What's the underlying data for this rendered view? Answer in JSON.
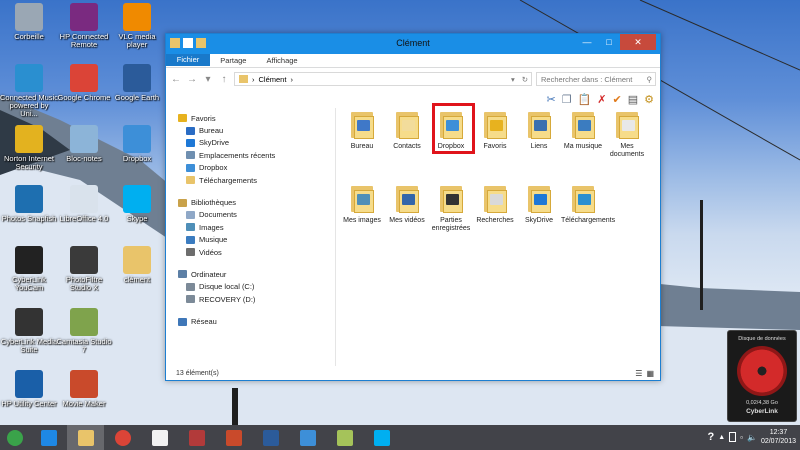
{
  "desktop_icons": [
    {
      "label": "Corbeille",
      "icon": "recycle-bin-icon",
      "color": "#9aa7b4"
    },
    {
      "label": "HP Connected Remote",
      "icon": "hp-connected-remote-icon",
      "color": "#7a2a80"
    },
    {
      "label": "VLC media player",
      "icon": "vlc-icon",
      "color": "#f08a00"
    },
    {
      "label": "Connected Music powered by Uni...",
      "icon": "connected-music-icon",
      "color": "#2a8fd0"
    },
    {
      "label": "Google Chrome",
      "icon": "chrome-icon",
      "color": "#db4437"
    },
    {
      "label": "Google Earth",
      "icon": "google-earth-icon",
      "color": "#2b5b9a"
    },
    {
      "label": "Norton Internet Security",
      "icon": "norton-icon",
      "color": "#e3b21f"
    },
    {
      "label": "Bloc-notes",
      "icon": "notepad-icon",
      "color": "#8cb4d8"
    },
    {
      "label": "Dropbox",
      "icon": "dropbox-icon",
      "color": "#3d8fd8"
    },
    {
      "label": "Photos Snapfish",
      "icon": "snapfish-icon",
      "color": "#1e6fb0"
    },
    {
      "label": "LibreOffice 4.0",
      "icon": "libreoffice-icon",
      "color": "#d9e2ec"
    },
    {
      "label": "Skype",
      "icon": "skype-icon",
      "color": "#00aff0"
    },
    {
      "label": "CyberLink YouCam",
      "icon": "youcam-icon",
      "color": "#222222"
    },
    {
      "label": "PhotoFiltre Studio X",
      "icon": "photofiltre-icon",
      "color": "#3a3a3a"
    },
    {
      "label": "clément",
      "icon": "user-folder-icon",
      "color": "#e9c46a"
    },
    {
      "label": "CyberLink Media Suite",
      "icon": "cyberlink-media-suite-icon",
      "color": "#333333"
    },
    {
      "label": "Camtasia Studio 7",
      "icon": "camtasia-icon",
      "color": "#7fa34c"
    },
    {
      "label": "HP Utility Center",
      "icon": "hp-utility-icon",
      "color": "#1a5fa8"
    },
    {
      "label": "Movie Maker",
      "icon": "movie-maker-icon",
      "color": "#c94a2b"
    }
  ],
  "window": {
    "title": "Clément",
    "tabs": [
      "Fichier",
      "Accueil",
      "Partage",
      "Affichage"
    ],
    "address": "Clément",
    "search_placeholder": "Rechercher dans : Clément",
    "status": "13 élément(s)"
  },
  "nav_pane": [
    {
      "label": "Favoris",
      "icon": "star-icon",
      "color": "#e7b21f",
      "level": 0
    },
    {
      "label": "Bureau",
      "icon": "desktop-icon",
      "color": "#2a6cc4",
      "level": 1
    },
    {
      "label": "SkyDrive",
      "icon": "cloud-icon",
      "color": "#1e78d6",
      "level": 1
    },
    {
      "label": "Emplacements récents",
      "icon": "recent-places-icon",
      "color": "#6f8fb0",
      "level": 1
    },
    {
      "label": "Dropbox",
      "icon": "dropbox-icon",
      "color": "#3d8fd8",
      "level": 1
    },
    {
      "label": "Téléchargements",
      "icon": "downloads-icon",
      "color": "#e9c46a",
      "level": 1
    },
    {
      "label": "Bibliothèques",
      "icon": "libraries-icon",
      "color": "#c9a24a",
      "level": 0,
      "gap": true
    },
    {
      "label": "Documents",
      "icon": "documents-icon",
      "color": "#8fa8c7",
      "level": 1
    },
    {
      "label": "Images",
      "icon": "pictures-icon",
      "color": "#4f8fb8",
      "level": 1
    },
    {
      "label": "Musique",
      "icon": "music-icon",
      "color": "#3b7cc0",
      "level": 1
    },
    {
      "label": "Vidéos",
      "icon": "videos-icon",
      "color": "#6d6d6d",
      "level": 1
    },
    {
      "label": "Ordinateur",
      "icon": "computer-icon",
      "color": "#5c7fa5",
      "level": 0,
      "gap": true
    },
    {
      "label": "Disque local (C:)",
      "icon": "drive-icon",
      "color": "#7c8a98",
      "level": 1
    },
    {
      "label": "RECOVERY (D:)",
      "icon": "drive-icon",
      "color": "#7c8a98",
      "level": 1
    },
    {
      "label": "Réseau",
      "icon": "network-icon",
      "color": "#3f77b8",
      "level": 0,
      "gap": true
    }
  ],
  "files": [
    {
      "label": "Bureau",
      "icon": "desktop-folder-icon",
      "color": "#3f78c8"
    },
    {
      "label": "Contacts",
      "icon": "contacts-folder-icon",
      "color": "#f2dc9b"
    },
    {
      "label": "Dropbox",
      "icon": "dropbox-folder-icon",
      "color": "#3d8fd8"
    },
    {
      "label": "Favoris",
      "icon": "favorites-folder-icon",
      "color": "#e7b21f"
    },
    {
      "label": "Liens",
      "icon": "links-folder-icon",
      "color": "#3a6fb0"
    },
    {
      "label": "Ma musique",
      "icon": "music-folder-icon",
      "color": "#3b7cc0"
    },
    {
      "label": "Mes documents",
      "icon": "documents-folder-icon",
      "color": "#e8e8e8"
    },
    {
      "label": "Mes images",
      "icon": "pictures-folder-icon",
      "color": "#4f8fb8"
    },
    {
      "label": "Mes vidéos",
      "icon": "videos-folder-icon",
      "color": "#3366aa"
    },
    {
      "label": "Parties enregistrées",
      "icon": "saved-games-folder-icon",
      "color": "#333333"
    },
    {
      "label": "Recherches",
      "icon": "searches-folder-icon",
      "color": "#d9d9d9"
    },
    {
      "label": "SkyDrive",
      "icon": "skydrive-folder-icon",
      "color": "#1e78d6"
    },
    {
      "label": "Téléchargements",
      "icon": "downloads-folder-icon",
      "color": "#2a8fd0"
    }
  ],
  "gadget": {
    "title": "Disque de données",
    "capacity": "0,02/4,38 Go",
    "brand": "CyberLink"
  },
  "taskbar": [
    {
      "icon": "windows-start-icon",
      "color": "#3aa34a"
    },
    {
      "icon": "internet-explorer-icon",
      "color": "#1e88e5"
    },
    {
      "icon": "file-explorer-icon",
      "color": "#e9c46a"
    },
    {
      "icon": "chrome-icon",
      "color": "#db4437"
    },
    {
      "icon": "notepad-icon",
      "color": "#f2f2f2"
    },
    {
      "icon": "photofiltre-icon",
      "color": "#b23a3a"
    },
    {
      "icon": "movie-maker-icon",
      "color": "#c94a2b"
    },
    {
      "icon": "google-earth-icon",
      "color": "#2b5b9a"
    },
    {
      "icon": "dropbox-icon",
      "color": "#3d8fd8"
    },
    {
      "icon": "camtasia-icon",
      "color": "#a5c35a"
    },
    {
      "icon": "skype-icon",
      "color": "#00aff0"
    }
  ],
  "clock": {
    "time": "12:37",
    "date": "02/07/2013"
  },
  "help_glyph": "?"
}
